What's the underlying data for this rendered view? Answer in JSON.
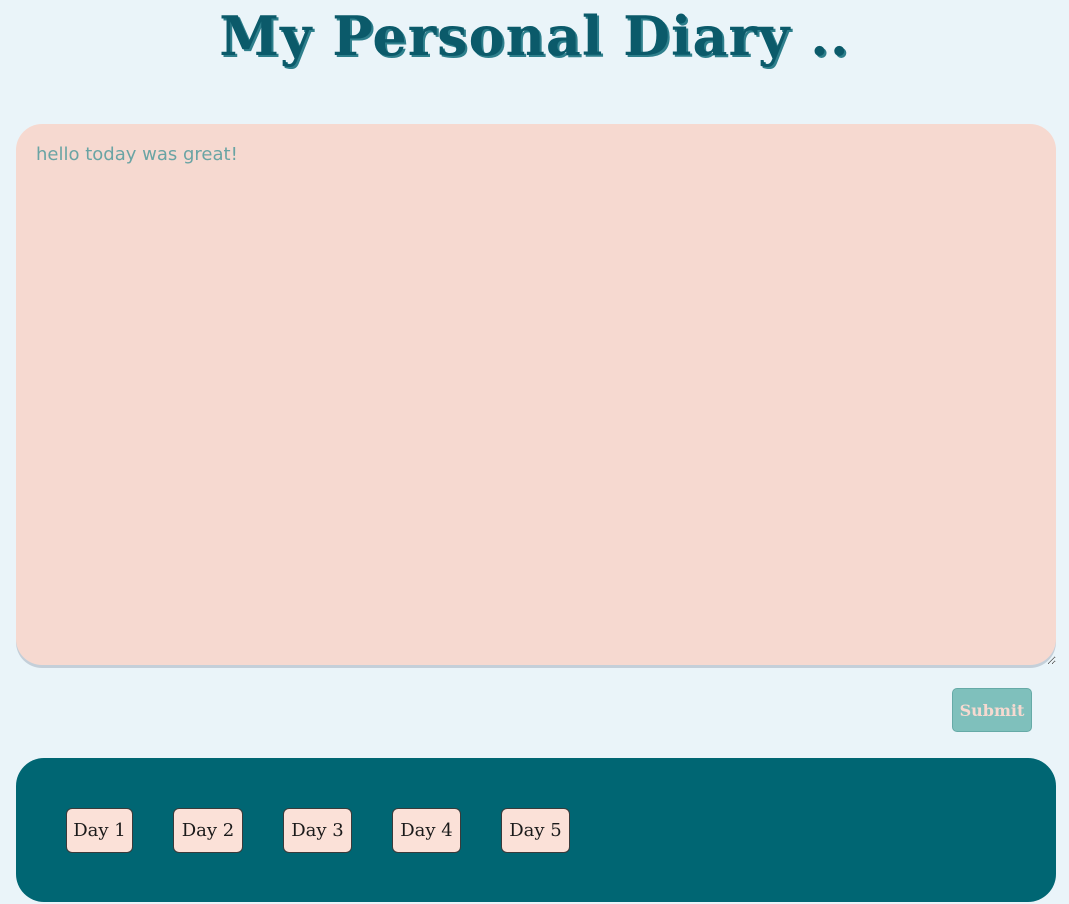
{
  "header": {
    "title": "My Personal Diary .."
  },
  "editor": {
    "value": "hello today was great!"
  },
  "actions": {
    "submit_label": "Submit"
  },
  "days": [
    {
      "label": "Day 1"
    },
    {
      "label": "Day 2"
    },
    {
      "label": "Day 3"
    },
    {
      "label": "Day 4"
    },
    {
      "label": "Day 5"
    }
  ],
  "colors": {
    "background": "#eaf4f9",
    "title": "#0b5a6a",
    "editor_bg": "#f6d9d0",
    "editor_text": "#6aa4a4",
    "submit_bg": "#7fc0bc",
    "panel_bg": "#006673",
    "day_button_bg": "#fbe1d8"
  }
}
